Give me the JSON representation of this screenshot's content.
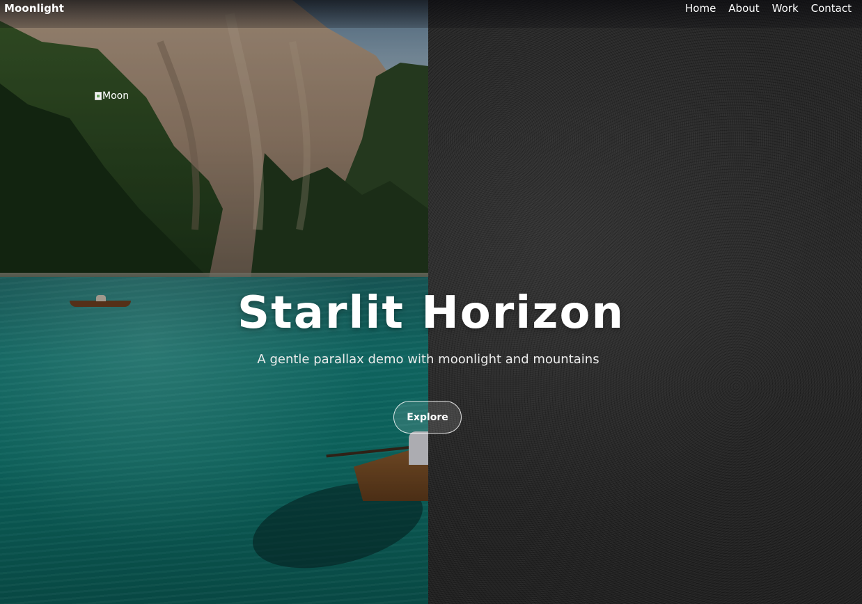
{
  "header": {
    "brand": "Moonlight",
    "nav": [
      {
        "label": "Home"
      },
      {
        "label": "About"
      },
      {
        "label": "Work"
      },
      {
        "label": "Contact"
      }
    ]
  },
  "hero": {
    "moon_image_alt": "Moon",
    "title": "Starlit Horizon",
    "subtitle": "A gentle parallax demo with moonlight and mountains",
    "cta_label": "Explore"
  },
  "colors": {
    "text": "#ffffff",
    "lake": "#0f7a72",
    "texture": "#262626"
  }
}
